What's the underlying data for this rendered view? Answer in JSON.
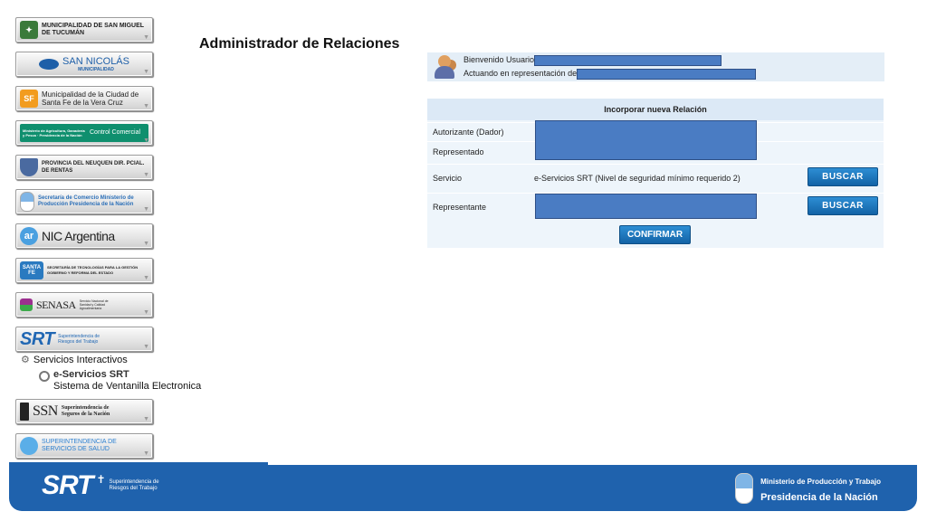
{
  "sidebar": {
    "items": [
      {
        "label": "MUNICIPALIDAD DE SAN MIGUEL DE TUCUMÁN",
        "style": "small",
        "icon": "coat-of-arms-icon",
        "color": "#3a7a3a"
      },
      {
        "label": "SAN NICOLÁS",
        "sublabel": "MUNICIPALIDAD",
        "style": "big",
        "icon": "wave-logo-icon",
        "color": "#1e5fa8"
      },
      {
        "label": "Municipalidad de la Ciudad de Santa Fe de la Vera Cruz",
        "style": "med",
        "icon": "sf-logo-icon",
        "mark": "SF",
        "color": "#f29c1f"
      },
      {
        "label": "Control Comercial",
        "sublabel": "Ministerio de Agricultura, Ganadería y Pesca · Presidencia de la Nación",
        "style": "small",
        "icon": "ministry-logo-icon",
        "color": "#0f8f6e"
      },
      {
        "label": "PROVINCIA DEL NEUQUEN DIR. PCIAL. DE RENTAS",
        "style": "small",
        "icon": "neuquen-shield-icon",
        "color": "#4a6aa0"
      },
      {
        "label": "Secretaría de Comercio Ministerio de Producción Presidencia de la Nación",
        "style": "small",
        "icon": "escudo-icon",
        "color": "#2b6fb8"
      },
      {
        "label": "NIC Argentina",
        "style": "big",
        "icon": "nic-logo-icon",
        "mark": "ar",
        "color": "#4aa0e0"
      },
      {
        "label": "SECRETARÍA DE TECNOLOGÍAS PARA LA GESTIÓN GOBIERNO Y REFORMA DEL ESTADO",
        "style": "small",
        "icon": "santa-fe-logo-icon",
        "mark": "SANTA FE",
        "color": "#2a7ac0"
      },
      {
        "label": "SENASA",
        "sublabel": "Servicio Nacional de Sanidad y Calidad Agroalimentaria",
        "style": "big",
        "icon": "senasa-logo-icon",
        "color": "#9c2f8f"
      },
      {
        "label": "SRT",
        "sublabel": "Superintendencia de Riesgos del Trabajo",
        "style": "big",
        "icon": "srt-logo-icon",
        "color": "#2167b3"
      }
    ],
    "tree": {
      "root": "Servicios Interactivos",
      "child_title": "e-Servicios SRT",
      "child_subtitle": "Sistema de Ventanilla Electronica"
    },
    "items_bottom": [
      {
        "label": "SSN",
        "sublabel": "Superintendencia de Seguros de la Nación",
        "style": "big",
        "icon": "ssn-logo-icon",
        "color": "#222222"
      },
      {
        "label": "SUPERINTENDENCIA DE SERVICIOS DE SALUD",
        "style": "small",
        "icon": "sss-logo-icon",
        "color": "#5aaee8"
      }
    ]
  },
  "main": {
    "title": "Administrador de Relaciones",
    "welcome": {
      "line1": "Bienvenido Usuario",
      "line2": "Actuando en representación de"
    },
    "form": {
      "header": "Incorporar nueva Relación",
      "rows": [
        {
          "label": "Autorizante (Dador)"
        },
        {
          "label": "Representado"
        },
        {
          "label": "Servicio",
          "value": "e-Servicios SRT (Nivel de seguridad mínimo requerido 2)",
          "button": "BUSCAR"
        },
        {
          "label": "Representante",
          "button": "BUSCAR"
        }
      ],
      "confirm_label": "CONFIRMAR"
    }
  },
  "footer": {
    "left_mark": "SRT",
    "left_sub": "Superintendencia de Riesgos del Trabajo",
    "right_line1": "Ministerio de Producción y Trabajo",
    "right_line2": "Presidencia de la Nación"
  },
  "colors": {
    "accent": "#1f62ad",
    "button": "#1a73bd",
    "redaction": "#4a7cc3",
    "panel": "#eef5fb"
  }
}
